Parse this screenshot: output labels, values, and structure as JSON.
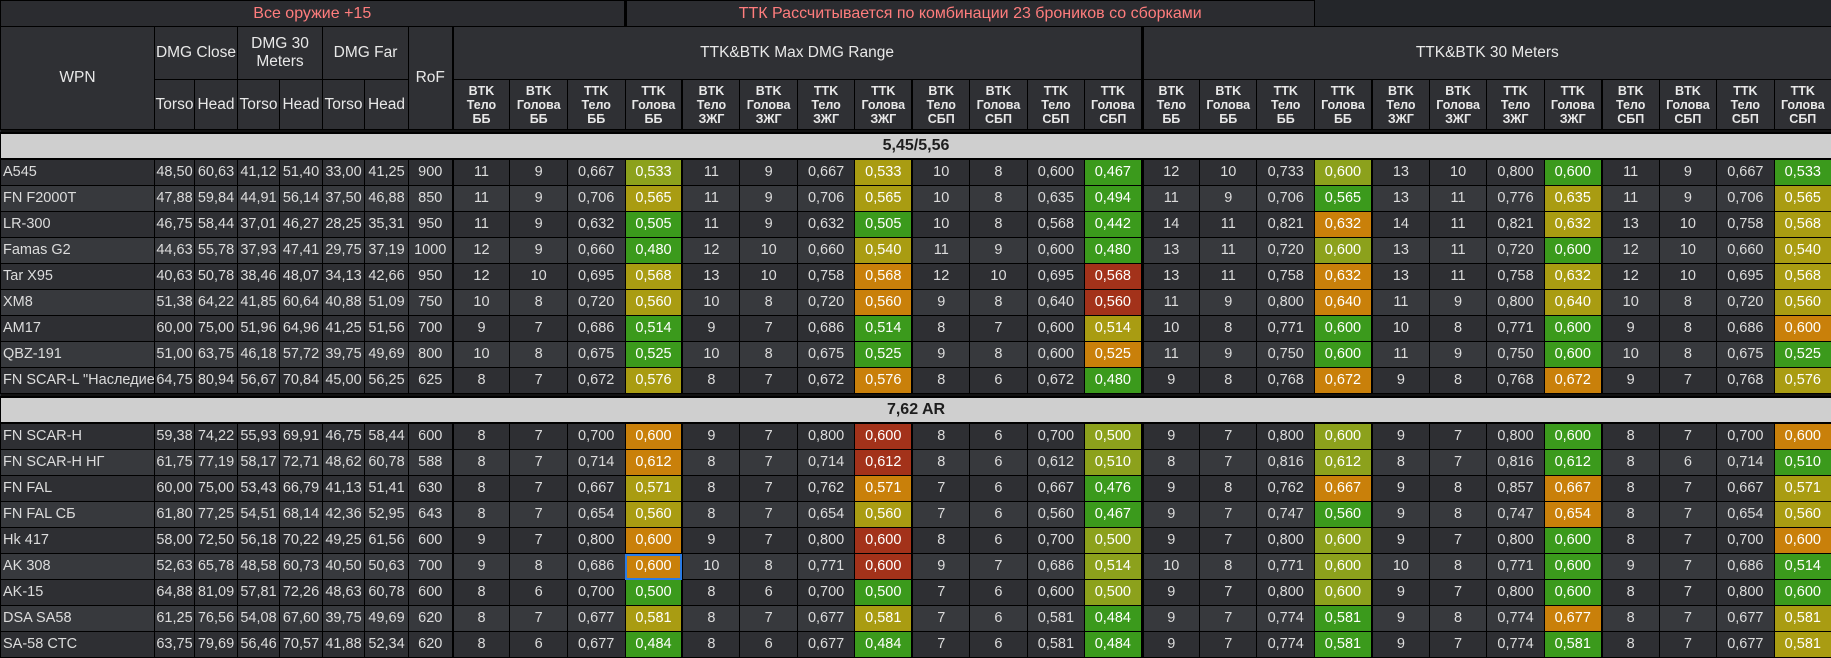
{
  "header": {
    "left_banner": "Все оружие +15",
    "right_banner": "ТТК Рассчитывается по комбинации 23 броников со сборками",
    "wpn": "WPN",
    "dmg_close": "DMG Close",
    "dmg_30": "DMG 30 Meters",
    "dmg_far": "DMG Far",
    "rof": "RoF",
    "group_max": "TTK&BTK Max DMG Range",
    "group_30": "TTK&BTK 30 Meters",
    "torso": "Torso",
    "head": "Head",
    "sub": [
      {
        "l1": "BTK",
        "l2": "Тело",
        "l3": "ББ",
        "cls": "bb"
      },
      {
        "l1": "BTK",
        "l2": "Голова",
        "l3": "ББ",
        "cls": "bb"
      },
      {
        "l1": "TTK",
        "l2": "Тело",
        "l3": "ББ",
        "cls": "bb"
      },
      {
        "l1": "TTK",
        "l2": "Голова",
        "l3": "ББ",
        "cls": "bb"
      },
      {
        "l1": "BTK",
        "l2": "Тело",
        "l3": "ЗЖГ",
        "cls": "zhg"
      },
      {
        "l1": "BTK",
        "l2": "Голова",
        "l3": "ЗЖГ",
        "cls": "zhg"
      },
      {
        "l1": "TTK",
        "l2": "Тело",
        "l3": "ЗЖГ",
        "cls": "zhg"
      },
      {
        "l1": "TTK",
        "l2": "Голова",
        "l3": "ЗЖГ",
        "cls": "zhg"
      },
      {
        "l1": "BTK",
        "l2": "Тело",
        "l3": "СБП",
        "cls": "sbp"
      },
      {
        "l1": "BTK",
        "l2": "Голова",
        "l3": "СБП",
        "cls": "sbp"
      },
      {
        "l1": "TTK",
        "l2": "Тело",
        "l3": "СБП",
        "cls": "sbp"
      },
      {
        "l1": "TTK",
        "l2": "Голова",
        "l3": "СБП",
        "cls": "sbp"
      }
    ]
  },
  "sections": [
    {
      "title": "5,45/5,56",
      "rows": [
        {
          "name": "A545",
          "v": [
            "48,50",
            "60,63",
            "41,12",
            "51,40",
            "33,00",
            "41,25",
            "900",
            "11",
            "9",
            "0,667",
            "0,533",
            "11",
            "9",
            "0,667",
            "0,533",
            "10",
            "8",
            "0,600",
            "0,467",
            "12",
            "10",
            "0,733",
            "0,600",
            "13",
            "10",
            "0,800",
            "0,600",
            "11",
            "9",
            "0,667",
            "0,533"
          ],
          "c": {
            "10": "lg",
            "14": "y",
            "18": "g",
            "22": "lg",
            "26": "g",
            "30": "g"
          }
        },
        {
          "name": "FN F2000T",
          "v": [
            "47,88",
            "59,84",
            "44,91",
            "56,14",
            "37,50",
            "46,88",
            "850",
            "11",
            "9",
            "0,706",
            "0,565",
            "11",
            "9",
            "0,706",
            "0,565",
            "10",
            "8",
            "0,635",
            "0,494",
            "11",
            "9",
            "0,706",
            "0,565",
            "13",
            "11",
            "0,776",
            "0,635",
            "11",
            "9",
            "0,706",
            "0,565"
          ],
          "c": {
            "10": "y",
            "14": "y",
            "18": "g",
            "22": "g",
            "26": "y",
            "30": "y"
          }
        },
        {
          "name": "LR-300",
          "v": [
            "46,75",
            "58,44",
            "37,01",
            "46,27",
            "28,25",
            "35,31",
            "950",
            "11",
            "9",
            "0,632",
            "0,505",
            "11",
            "9",
            "0,632",
            "0,505",
            "10",
            "8",
            "0,568",
            "0,442",
            "14",
            "11",
            "0,821",
            "0,632",
            "14",
            "11",
            "0,821",
            "0,632",
            "13",
            "10",
            "0,758",
            "0,568"
          ],
          "c": {
            "10": "g",
            "14": "g",
            "18": "g",
            "22": "o",
            "26": "y",
            "30": "y"
          }
        },
        {
          "name": "Famas G2",
          "v": [
            "44,63",
            "55,78",
            "37,93",
            "47,41",
            "29,75",
            "37,19",
            "1000",
            "12",
            "9",
            "0,660",
            "0,480",
            "12",
            "10",
            "0,660",
            "0,540",
            "11",
            "9",
            "0,600",
            "0,480",
            "13",
            "11",
            "0,720",
            "0,600",
            "13",
            "11",
            "0,720",
            "0,600",
            "12",
            "10",
            "0,660",
            "0,540"
          ],
          "c": {
            "10": "g",
            "14": "y",
            "18": "g",
            "22": "lg",
            "26": "g",
            "30": "y"
          }
        },
        {
          "name": "Tar X95",
          "v": [
            "40,63",
            "50,78",
            "38,46",
            "48,07",
            "34,13",
            "42,66",
            "950",
            "12",
            "10",
            "0,695",
            "0,568",
            "13",
            "10",
            "0,758",
            "0,568",
            "12",
            "10",
            "0,695",
            "0,568",
            "13",
            "11",
            "0,758",
            "0,632",
            "13",
            "11",
            "0,758",
            "0,632",
            "12",
            "10",
            "0,695",
            "0,568"
          ],
          "c": {
            "10": "y",
            "14": "o",
            "18": "r",
            "22": "o",
            "26": "y",
            "30": "y"
          }
        },
        {
          "name": "XM8",
          "v": [
            "51,38",
            "64,22",
            "41,85",
            "60,64",
            "40,88",
            "51,09",
            "750",
            "10",
            "8",
            "0,720",
            "0,560",
            "10",
            "8",
            "0,720",
            "0,560",
            "9",
            "8",
            "0,640",
            "0,560",
            "11",
            "9",
            "0,800",
            "0,640",
            "11",
            "9",
            "0,800",
            "0,640",
            "10",
            "8",
            "0,720",
            "0,560"
          ],
          "c": {
            "10": "y",
            "14": "o",
            "18": "r",
            "22": "o",
            "26": "y",
            "30": "y"
          }
        },
        {
          "name": "AM17",
          "v": [
            "60,00",
            "75,00",
            "51,96",
            "64,96",
            "41,25",
            "51,56",
            "700",
            "9",
            "7",
            "0,686",
            "0,514",
            "9",
            "7",
            "0,686",
            "0,514",
            "8",
            "7",
            "0,600",
            "0,514",
            "10",
            "8",
            "0,771",
            "0,600",
            "10",
            "8",
            "0,771",
            "0,600",
            "9",
            "8",
            "0,686",
            "0,600"
          ],
          "c": {
            "10": "g",
            "14": "g",
            "18": "y",
            "22": "g",
            "26": "g",
            "30": "o"
          }
        },
        {
          "name": "QBZ-191",
          "v": [
            "51,00",
            "63,75",
            "46,18",
            "57,72",
            "39,75",
            "49,69",
            "800",
            "10",
            "8",
            "0,675",
            "0,525",
            "10",
            "8",
            "0,675",
            "0,525",
            "9",
            "8",
            "0,600",
            "0,525",
            "11",
            "9",
            "0,750",
            "0,600",
            "11",
            "9",
            "0,750",
            "0,600",
            "10",
            "8",
            "0,675",
            "0,525"
          ],
          "c": {
            "10": "g",
            "14": "g",
            "18": "o",
            "22": "g",
            "26": "g",
            "30": "g"
          }
        },
        {
          "name": "FN SCAR-L \"Наследие\"",
          "v": [
            "64,75",
            "80,94",
            "56,67",
            "70,84",
            "45,00",
            "56,25",
            "625",
            "8",
            "7",
            "0,672",
            "0,576",
            "8",
            "7",
            "0,672",
            "0,576",
            "8",
            "6",
            "0,672",
            "0,480",
            "9",
            "8",
            "0,768",
            "0,672",
            "9",
            "8",
            "0,768",
            "0,672",
            "9",
            "7",
            "0,768",
            "0,576"
          ],
          "c": {
            "10": "y",
            "14": "o",
            "18": "g",
            "22": "o",
            "26": "o",
            "30": "y"
          }
        }
      ]
    },
    {
      "title": "7,62 AR",
      "rows": [
        {
          "name": "FN SCAR-H",
          "v": [
            "59,38",
            "74,22",
            "55,93",
            "69,91",
            "46,75",
            "58,44",
            "600",
            "8",
            "7",
            "0,700",
            "0,600",
            "9",
            "7",
            "0,800",
            "0,600",
            "8",
            "6",
            "0,700",
            "0,500",
            "9",
            "7",
            "0,800",
            "0,600",
            "9",
            "7",
            "0,800",
            "0,600",
            "8",
            "7",
            "0,700",
            "0,600"
          ],
          "c": {
            "10": "o",
            "14": "r",
            "18": "lg",
            "22": "lg",
            "26": "g",
            "30": "o"
          }
        },
        {
          "name": "FN SCAR-H НГ",
          "v": [
            "61,75",
            "77,19",
            "58,17",
            "72,71",
            "48,62",
            "60,78",
            "588",
            "8",
            "7",
            "0,714",
            "0,612",
            "8",
            "7",
            "0,714",
            "0,612",
            "8",
            "6",
            "0,612",
            "0,510",
            "8",
            "7",
            "0,816",
            "0,612",
            "8",
            "7",
            "0,816",
            "0,612",
            "8",
            "6",
            "0,714",
            "0,510"
          ],
          "c": {
            "10": "o",
            "14": "r",
            "18": "lg",
            "22": "lg",
            "26": "g",
            "30": "g"
          }
        },
        {
          "name": "FN FAL",
          "v": [
            "60,00",
            "75,00",
            "53,43",
            "66,79",
            "41,13",
            "51,41",
            "630",
            "8",
            "7",
            "0,667",
            "0,571",
            "8",
            "7",
            "0,762",
            "0,571",
            "7",
            "6",
            "0,667",
            "0,476",
            "9",
            "8",
            "0,762",
            "0,667",
            "9",
            "8",
            "0,857",
            "0,667",
            "8",
            "7",
            "0,667",
            "0,571"
          ],
          "c": {
            "10": "y",
            "14": "o",
            "18": "g",
            "22": "o",
            "26": "o",
            "30": "y"
          }
        },
        {
          "name": "FN FAL СБ",
          "v": [
            "61,80",
            "77,25",
            "54,51",
            "68,14",
            "42,36",
            "52,95",
            "643",
            "8",
            "7",
            "0,654",
            "0,560",
            "8",
            "7",
            "0,654",
            "0,560",
            "7",
            "6",
            "0,560",
            "0,467",
            "9",
            "7",
            "0,747",
            "0,560",
            "9",
            "8",
            "0,747",
            "0,654",
            "8",
            "7",
            "0,654",
            "0,560"
          ],
          "c": {
            "10": "y",
            "14": "y",
            "18": "g",
            "22": "g",
            "26": "o",
            "30": "y"
          }
        },
        {
          "name": "Hk 417",
          "v": [
            "58,00",
            "72,50",
            "56,18",
            "70,22",
            "49,25",
            "61,56",
            "600",
            "9",
            "7",
            "0,800",
            "0,600",
            "9",
            "7",
            "0,800",
            "0,600",
            "8",
            "6",
            "0,700",
            "0,500",
            "9",
            "7",
            "0,800",
            "0,600",
            "9",
            "7",
            "0,800",
            "0,600",
            "8",
            "7",
            "0,700",
            "0,600"
          ],
          "c": {
            "10": "o",
            "14": "r",
            "18": "lg",
            "22": "lg",
            "26": "g",
            "30": "o"
          }
        },
        {
          "name": "AK 308",
          "v": [
            "52,63",
            "65,78",
            "48,58",
            "60,73",
            "40,50",
            "50,63",
            "700",
            "9",
            "8",
            "0,686",
            "0,600",
            "10",
            "8",
            "0,771",
            "0,600",
            "9",
            "7",
            "0,686",
            "0,514",
            "10",
            "8",
            "0,771",
            "0,600",
            "10",
            "8",
            "0,771",
            "0,600",
            "9",
            "7",
            "0,686",
            "0,514"
          ],
          "c": {
            "10": "o",
            "14": "r",
            "18": "lg",
            "22": "lg",
            "26": "g",
            "30": "g"
          },
          "sel": "10"
        },
        {
          "name": "AK-15",
          "v": [
            "64,88",
            "81,09",
            "57,81",
            "72,26",
            "48,63",
            "60,78",
            "600",
            "8",
            "6",
            "0,700",
            "0,500",
            "8",
            "6",
            "0,700",
            "0,500",
            "7",
            "6",
            "0,600",
            "0,500",
            "9",
            "7",
            "0,800",
            "0,600",
            "9",
            "7",
            "0,800",
            "0,600",
            "8",
            "7",
            "0,800",
            "0,600"
          ],
          "c": {
            "10": "g",
            "14": "g",
            "18": "lg",
            "22": "lg",
            "26": "g",
            "30": "g"
          }
        },
        {
          "name": "DSA SA58",
          "v": [
            "61,25",
            "76,56",
            "54,08",
            "67,60",
            "39,75",
            "49,69",
            "620",
            "8",
            "7",
            "0,677",
            "0,581",
            "8",
            "7",
            "0,677",
            "0,581",
            "7",
            "6",
            "0,581",
            "0,484",
            "9",
            "7",
            "0,774",
            "0,581",
            "9",
            "8",
            "0,774",
            "0,677",
            "8",
            "7",
            "0,677",
            "0,581"
          ],
          "c": {
            "10": "y",
            "14": "y",
            "18": "g",
            "22": "g",
            "26": "o",
            "30": "y"
          }
        },
        {
          "name": "SA-58 CTC",
          "v": [
            "63,75",
            "79,69",
            "56,46",
            "70,57",
            "41,88",
            "52,34",
            "620",
            "8",
            "6",
            "0,677",
            "0,484",
            "8",
            "6",
            "0,677",
            "0,484",
            "7",
            "6",
            "0,581",
            "0,484",
            "9",
            "7",
            "0,774",
            "0,581",
            "9",
            "7",
            "0,774",
            "0,581",
            "8",
            "7",
            "0,677",
            "0,581"
          ],
          "c": {
            "10": "g",
            "14": "g",
            "18": "g",
            "22": "g",
            "26": "g",
            "30": "y"
          }
        }
      ]
    }
  ]
}
